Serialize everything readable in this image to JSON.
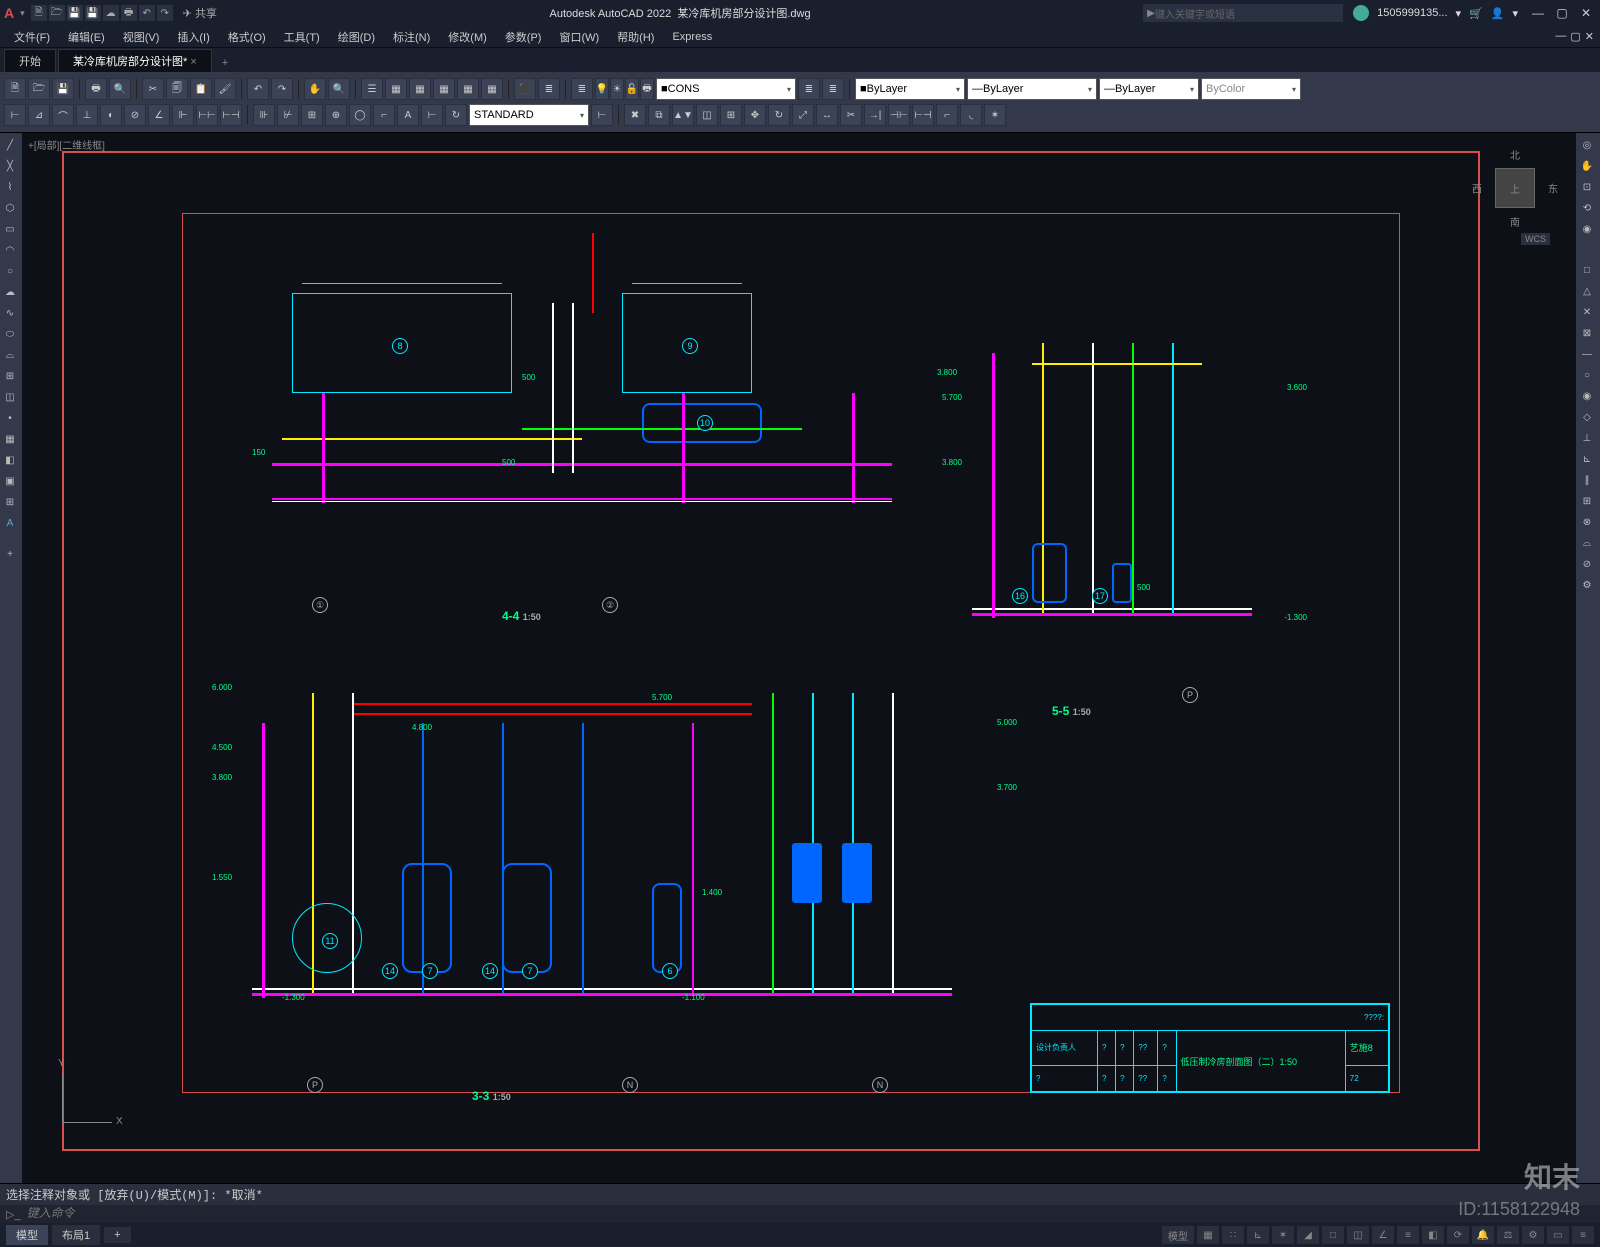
{
  "title_app": "Autodesk AutoCAD 2022",
  "title_file": "某冷库机房部分设计图.dwg",
  "share_label": "共享",
  "search_placeholder": "键入关键字或短语",
  "user_name": "1505999135...",
  "menus": [
    "文件(F)",
    "编辑(E)",
    "视图(V)",
    "插入(I)",
    "格式(O)",
    "工具(T)",
    "绘图(D)",
    "标注(N)",
    "修改(M)",
    "参数(P)",
    "窗口(W)",
    "帮助(H)",
    "Express"
  ],
  "tabs": {
    "start": "开始",
    "active": "某冷库机房部分设计图*",
    "plus": "+"
  },
  "layer_value": "CONS",
  "prop_bylayer1": "ByLayer",
  "prop_bylayer2": "ByLayer",
  "prop_bylayer3": "ByLayer",
  "prop_bycolor": "ByColor",
  "textstyle": "STANDARD",
  "viewcube": {
    "n": "北",
    "s": "南",
    "e": "东",
    "w": "西",
    "top": "上",
    "wcs": "WCS"
  },
  "ucs": {
    "x": "X",
    "y": "Y"
  },
  "sections": {
    "s44": {
      "label": "4-4",
      "scale": "1:50",
      "marks": [
        "①",
        "②"
      ],
      "tags": [
        "8",
        "9",
        "10"
      ],
      "dims": [
        "5.700",
        "3.800",
        "150",
        "500",
        "500"
      ]
    },
    "s55": {
      "label": "5-5",
      "scale": "1:50",
      "marks": [
        "P"
      ],
      "tags": [
        "16",
        "17"
      ],
      "dims": [
        "3.800",
        "3.600",
        "500",
        "-1.300"
      ]
    },
    "s33": {
      "label": "3-3",
      "scale": "1:50",
      "marks": [
        "P",
        "N",
        "N"
      ],
      "tags": [
        "11",
        "14",
        "7",
        "14",
        "7",
        "6"
      ],
      "dims": [
        "6.000",
        "4.500",
        "4.800",
        "5.700",
        "5.000",
        "3.800",
        "1.550",
        "-1.300",
        "3.700",
        "1.400",
        "-1.100"
      ]
    }
  },
  "titleblock": {
    "header": "????:",
    "row1": [
      "设计负责人",
      "?",
      "?",
      "??",
      "?",
      "低压制冷房剖面图（二）1:50",
      "艺施8"
    ],
    "row2": [
      "?",
      "?",
      "?",
      "??",
      "?",
      "",
      "72"
    ]
  },
  "cmdline_text": "选择注释对象或  [放弃(U)/模式(M)]:  *取消*",
  "cmd_placeholder": "键入命令",
  "status": {
    "model": "模型",
    "layout": "布局1",
    "mode": "模型",
    "idmark": "ID:1158122948",
    "watermark": "知末"
  },
  "workspace_label": "+[局部][二维线框]"
}
